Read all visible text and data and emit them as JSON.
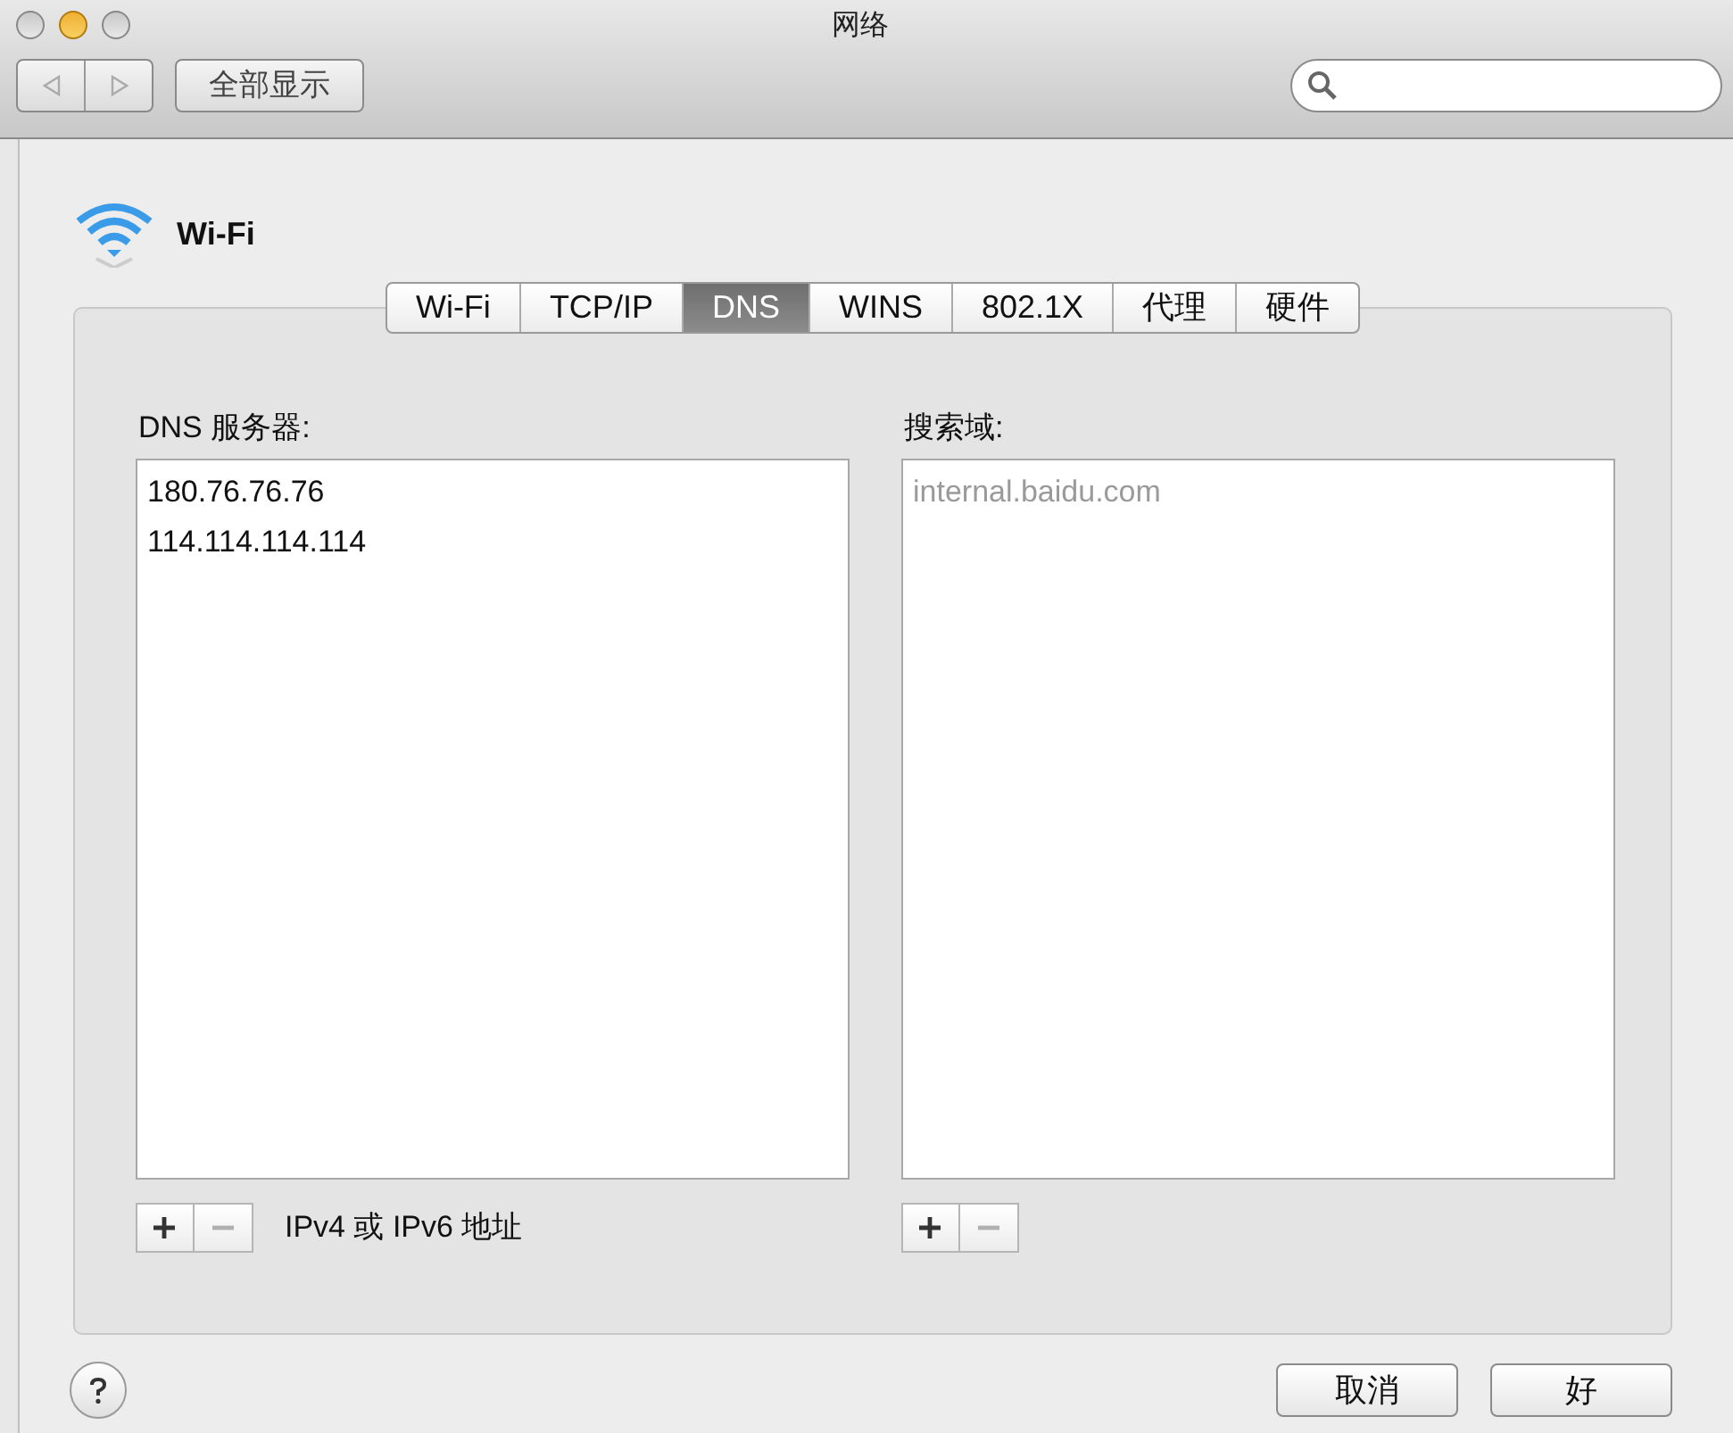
{
  "window": {
    "title": "网络"
  },
  "toolbar": {
    "show_all": "全部显示"
  },
  "header": {
    "title": "Wi-Fi"
  },
  "tabs": [
    {
      "label": "Wi-Fi",
      "selected": false
    },
    {
      "label": "TCP/IP",
      "selected": false
    },
    {
      "label": "DNS",
      "selected": true
    },
    {
      "label": "WINS",
      "selected": false
    },
    {
      "label": "802.1X",
      "selected": false
    },
    {
      "label": "代理",
      "selected": false
    },
    {
      "label": "硬件",
      "selected": false
    }
  ],
  "dns_servers": {
    "label": "DNS 服务器:",
    "items": [
      "180.76.76.76",
      "114.114.114.114"
    ],
    "add_disabled": false,
    "remove_disabled": true,
    "hint": "IPv4 或 IPv6 地址"
  },
  "search_domains": {
    "label": "搜索域:",
    "items": [
      "internal.baidu.com"
    ],
    "add_disabled": false,
    "remove_disabled": true
  },
  "buttons": [
    {
      "label": "取消"
    },
    {
      "label": "好"
    }
  ]
}
